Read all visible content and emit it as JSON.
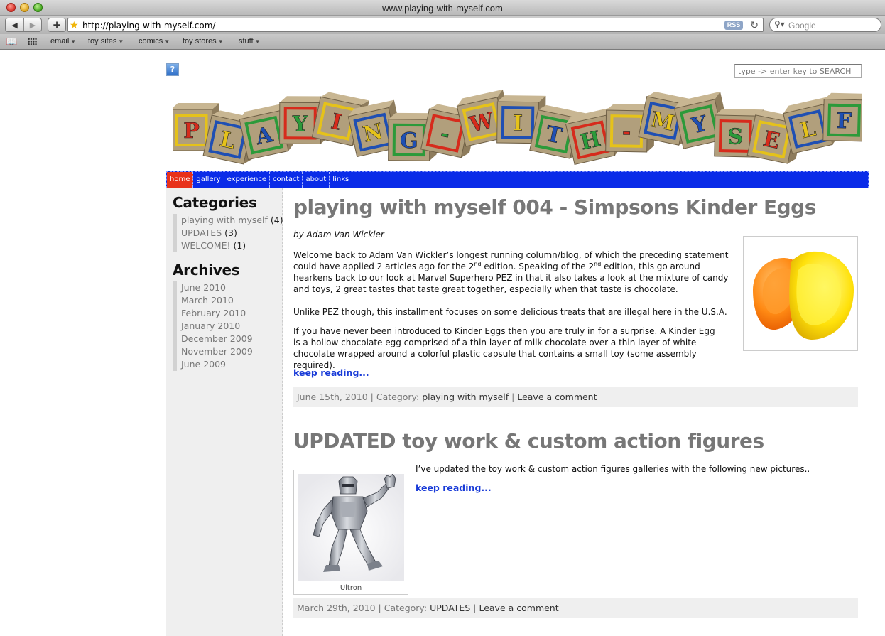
{
  "window": {
    "title": "www.playing-with-myself.com"
  },
  "toolbar": {
    "back": "◀",
    "forward": "▶",
    "add": "+",
    "url": "http://playing-with-myself.com/",
    "rss": "RSS",
    "search_placeholder": "Google"
  },
  "bookmarks": [
    {
      "label": "email"
    },
    {
      "label": "toy sites"
    },
    {
      "label": "comics"
    },
    {
      "label": "toy stores"
    },
    {
      "label": "stuff"
    }
  ],
  "page": {
    "help": "?",
    "search_placeholder": "type -> enter key to SEARCH",
    "banner_letters": [
      "P",
      "L",
      "A",
      "Y",
      "I",
      "N",
      "G",
      "-",
      "W",
      "I",
      "T",
      "H",
      "-",
      "M",
      "Y",
      "S",
      "E",
      "L",
      "F"
    ],
    "nav": [
      {
        "label": "home",
        "active": true
      },
      {
        "label": "gallery"
      },
      {
        "label": "experience"
      },
      {
        "label": "contact"
      },
      {
        "label": "about"
      },
      {
        "label": "links"
      }
    ]
  },
  "sidebar": {
    "categories_heading": "Categories",
    "categories": [
      {
        "label": "playing with myself",
        "count": "(4)"
      },
      {
        "label": "UPDATES",
        "count": "(3)"
      },
      {
        "label": "WELCOME!",
        "count": "(1)"
      }
    ],
    "archives_heading": "Archives",
    "archives": [
      "June 2010",
      "March 2010",
      "February 2010",
      "January 2010",
      "December 2009",
      "November 2009",
      "June 2009"
    ]
  },
  "posts": [
    {
      "title": "playing with myself 004 - Simpsons Kinder Eggs",
      "byline": "by Adam Van Wickler",
      "p1a": "Welcome back to Adam Van Wickler’s longest running column/blog, of which the preceding statement could have applied 2 articles ago for the 2",
      "p1b": "nd",
      "p1c": " edition. Speaking of the 2",
      "p1d": "nd",
      "p1e": " edition, this go around hearkens back to our look at Marvel Superhero PEZ in that it also takes a look at the mixture of candy and toys, 2 great tastes that taste great together, especially when that taste is chocolate.",
      "p2": "Unlike PEZ though, this installment focuses on some delicious treats that are illegal here in the U.S.A.",
      "p3": "If you have never been introduced to Kinder Eggs then you are truly in for a surprise. A Kinder Egg is a hollow chocolate egg comprised of a thin layer of milk chocolate over a thin layer of white chocolate wrapped around a colorful plastic capsule that contains a small toy (some assembly required).",
      "read_more": "keep reading...",
      "date": "June 15th, 2010",
      "category_prefix": " | Category: ",
      "category": "playing with myself",
      "sep": " | ",
      "comment": "Leave a comment"
    },
    {
      "title": "UPDATED toy work & custom action figures",
      "p1": "I’ve updated the toy work & custom action figures galleries with the following new pictures..",
      "read_more": "keep reading...",
      "caption": "Ultron",
      "date": "March 29th, 2010",
      "category_prefix": " | Category: ",
      "category": "UPDATES",
      "sep": " | ",
      "comment": "Leave a comment"
    }
  ]
}
